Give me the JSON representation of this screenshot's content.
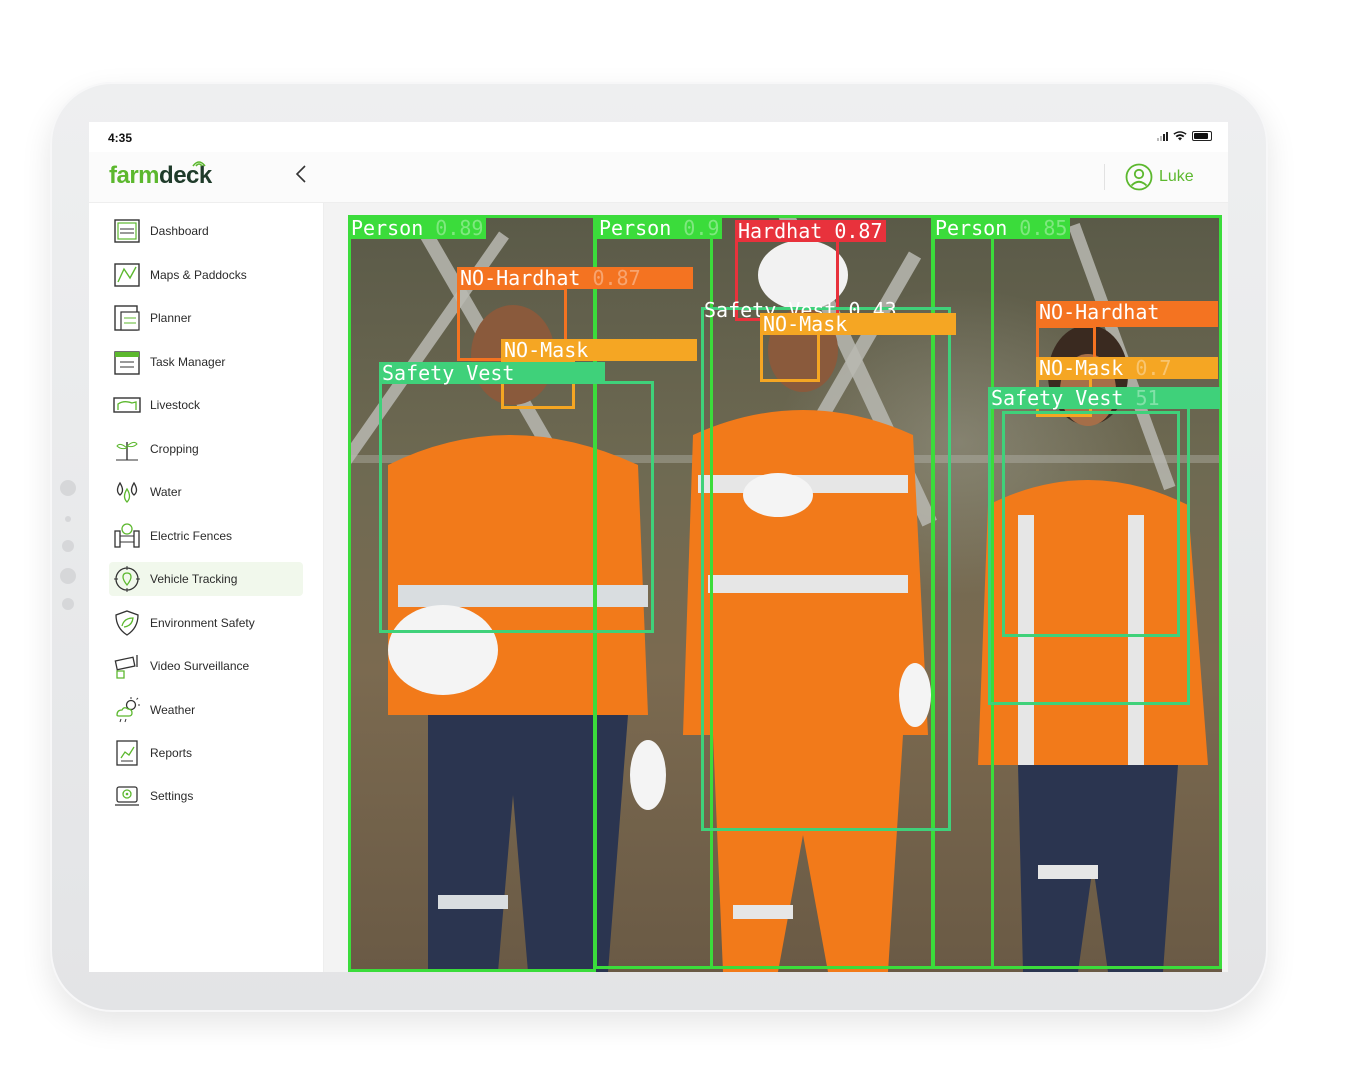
{
  "status_bar": {
    "time": "4:35"
  },
  "header": {
    "logo_part1": "farm",
    "logo_part2": "deck",
    "user_name": "Luke"
  },
  "sidebar": {
    "items": [
      {
        "label": "Dashboard",
        "icon": "dashboard-icon"
      },
      {
        "label": "Maps & Paddocks",
        "icon": "map-icon"
      },
      {
        "label": "Planner",
        "icon": "planner-icon"
      },
      {
        "label": "Task Manager",
        "icon": "calendar-icon"
      },
      {
        "label": "Livestock",
        "icon": "livestock-icon"
      },
      {
        "label": "Cropping",
        "icon": "plant-icon"
      },
      {
        "label": "Water",
        "icon": "water-drops-icon"
      },
      {
        "label": "Electric Fences",
        "icon": "fence-icon"
      },
      {
        "label": "Vehicle Tracking",
        "icon": "location-pin-icon",
        "active": true
      },
      {
        "label": "Environment Safety",
        "icon": "shield-leaf-icon"
      },
      {
        "label": "Video Surveillance",
        "icon": "camera-icon"
      },
      {
        "label": "Weather",
        "icon": "weather-icon"
      },
      {
        "label": "Reports",
        "icon": "report-icon"
      },
      {
        "label": "Settings",
        "icon": "settings-icon"
      }
    ]
  },
  "detections": [
    {
      "label": "Person",
      "score": "0.89",
      "color": "#3bdc3b"
    },
    {
      "label": "Person",
      "score": "0.9",
      "color": "#3bdc3b"
    },
    {
      "label": "Hardhat",
      "score": "0.87",
      "color": "#e8323c"
    },
    {
      "label": "Person",
      "score": "0.85",
      "color": "#3bdc3b"
    },
    {
      "label": "NO-Hardhat",
      "score": "0.87",
      "color": "#f47321"
    },
    {
      "label": "NO-Mask",
      "score": "",
      "color": "#f5a623"
    },
    {
      "label": "Safety Vest",
      "score": "",
      "color": "#3fd17a"
    },
    {
      "label": "Safety Vest",
      "score": "0.43",
      "color": "#3fd17a"
    },
    {
      "label": "NO-Mask",
      "score": "",
      "color": "#f5a623"
    },
    {
      "label": "NO-Hardhat",
      "score": "",
      "color": "#f47321"
    },
    {
      "label": "NO-Mask",
      "score": "0.7",
      "color": "#f5a623"
    },
    {
      "label": "Safety Vest",
      "score": "51",
      "color": "#3fd17a"
    }
  ],
  "colors": {
    "brand_green": "#5cb82e",
    "brand_dark": "#1f3b2a",
    "active_bg": "#f1f8ec"
  }
}
